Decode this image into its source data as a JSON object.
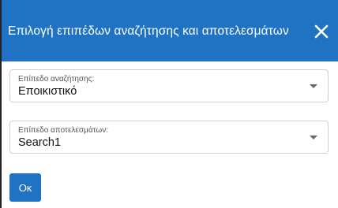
{
  "dialog": {
    "title": "Επιλογή επιπέδων αναζήτησης και αποτελεσμάτων",
    "close_icon": "close-icon"
  },
  "search_level": {
    "label": "Επίπεδο αναζήτησης:",
    "value": "Εποικιστικό",
    "icon": "chevron-down-icon"
  },
  "results_level": {
    "label": "Επίπεδο αποτελεσμάτων:",
    "value": "Search1",
    "icon": "chevron-down-icon"
  },
  "ok_button": {
    "label": "Οκ"
  },
  "colors": {
    "accent": "#1f73c2",
    "header_text": "#ffffff",
    "field_border": "#cfcfcf"
  }
}
